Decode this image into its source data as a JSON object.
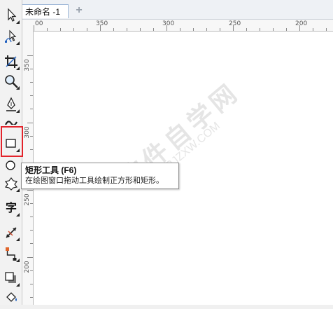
{
  "document_tab": {
    "title": "未命名 -1",
    "add_label": "+"
  },
  "ruler_top": {
    "ticks": [
      "00",
      "350",
      "300",
      "250",
      "200"
    ]
  },
  "ruler_left": {
    "ticks": [
      "350",
      "300",
      "250",
      "200"
    ]
  },
  "toolbox": {
    "tools": [
      {
        "name": "pick-tool",
        "icon": "arrow-cursor-icon"
      },
      {
        "name": "shape-tool",
        "icon": "node-edit-icon"
      },
      {
        "name": "crop-tool",
        "icon": "crop-icon"
      },
      {
        "name": "zoom-tool",
        "icon": "magnifier-icon"
      },
      {
        "name": "freehand-tool",
        "icon": "pen-nib-icon"
      },
      {
        "name": "artistic-media-tool",
        "icon": "brush-icon"
      },
      {
        "name": "rectangle-tool",
        "icon": "rectangle-icon"
      },
      {
        "name": "ellipse-tool",
        "icon": "ellipse-icon"
      },
      {
        "name": "polygon-tool",
        "icon": "star-shape-icon"
      },
      {
        "name": "text-tool",
        "icon": "text-icon"
      },
      {
        "name": "dimension-tool",
        "icon": "dimension-line-icon"
      },
      {
        "name": "connector-tool",
        "icon": "connector-icon"
      },
      {
        "name": "drop-shadow-tool",
        "icon": "shadow-icon"
      },
      {
        "name": "fill-tool",
        "icon": "fill-bucket-icon"
      }
    ],
    "text_tool_glyph": "字"
  },
  "tooltip": {
    "title": "矩形工具 (F6)",
    "description": "在绘图窗口拖动工具绘制正方形和矩形。"
  },
  "watermark": {
    "text": "软件自学网",
    "url": "RJZXW.COM"
  },
  "colors": {
    "highlight": "#e3232b",
    "canvas": "#ffffff",
    "tab_border": "#9fb8d8"
  }
}
